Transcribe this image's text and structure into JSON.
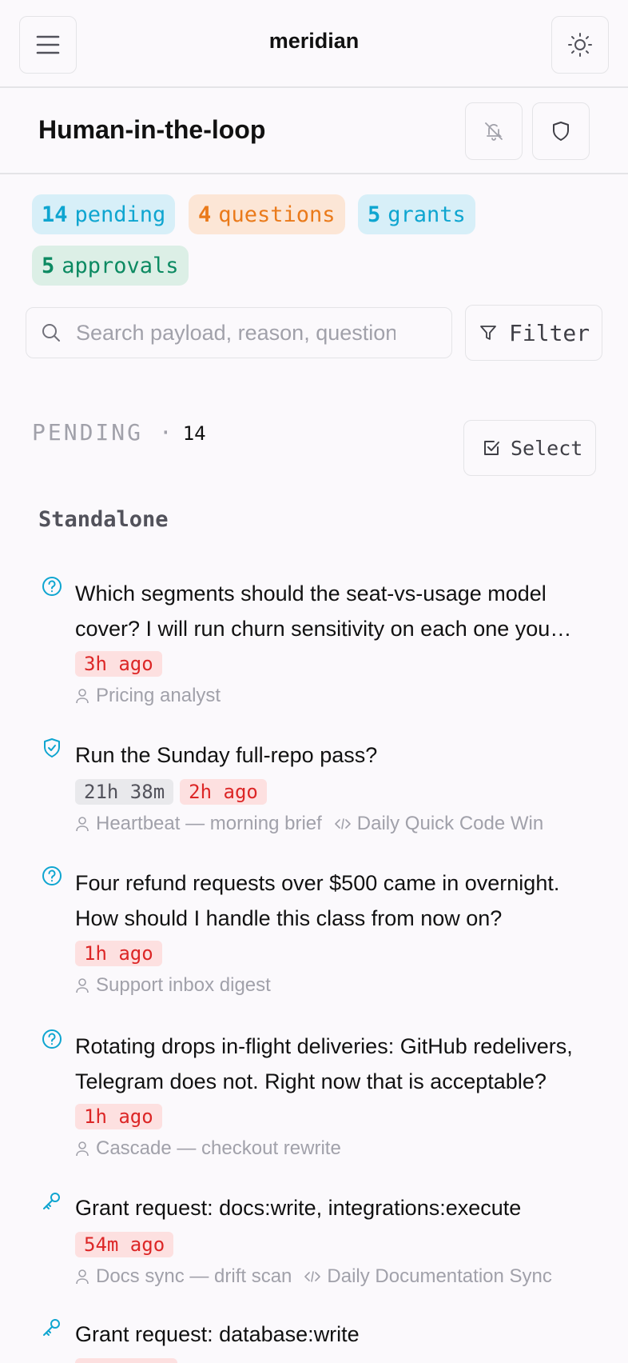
{
  "app": {
    "title": "meridian"
  },
  "page": {
    "title": "Human-in-the-loop"
  },
  "icons": {
    "menu": "menu-icon",
    "theme": "sun-icon",
    "mute": "bell-off-icon",
    "shield": "shield-icon",
    "search": "search-icon",
    "filter": "filter-icon",
    "select": "checkbox-icon",
    "question": "help-circle-icon",
    "approval": "shield-check-icon",
    "grant": "key-icon",
    "agent": "user-icon",
    "code": "code-icon"
  },
  "colors": {
    "accent": "#0ea5d0",
    "warning": "#ea7a1a",
    "success": "#0c8a62",
    "danger": "#dc2626"
  },
  "stats": [
    {
      "count": "14",
      "label": "pending"
    },
    {
      "count": "4",
      "label": "questions"
    },
    {
      "count": "5",
      "label": "grants"
    },
    {
      "count": "5",
      "label": "approvals"
    }
  ],
  "search": {
    "placeholder": "Search payload, reason, question"
  },
  "filter": {
    "label": "Filter"
  },
  "section": {
    "label": "PENDING ·",
    "count": "14",
    "select_label": "Select"
  },
  "group": {
    "label": "Standalone"
  },
  "items": [
    {
      "type": "question",
      "text": "Which segments should the seat-vs-usage model cover? I will run churn sensitivity on each one you pick.",
      "badges": [
        "3h ago"
      ],
      "agent": "Pricing analyst",
      "source": ""
    },
    {
      "type": "approval",
      "text": "Run the Sunday full-repo pass?",
      "badges": [
        "21h 38m",
        "2h ago"
      ],
      "agent": "Heartbeat — morning brief",
      "source": "Daily Quick Code Win"
    },
    {
      "type": "question",
      "text": "Four refund requests over $500 came in overnight. How should I handle this class from now on?",
      "badges": [
        "1h ago"
      ],
      "agent": "Support inbox digest",
      "source": ""
    },
    {
      "type": "question",
      "text": "Rotating drops in-flight deliveries: GitHub redelivers, Telegram does not. Right now that is acceptable?",
      "badges": [
        "1h ago"
      ],
      "agent": "Cascade — checkout rewrite",
      "source": ""
    },
    {
      "type": "grant",
      "text": "Grant request: docs:write, integrations:execute",
      "badges": [
        "54m ago"
      ],
      "agent": "Docs sync — drift scan",
      "source": "Daily Documentation Sync"
    },
    {
      "type": "grant",
      "text": "Grant request: database:write",
      "badges": [],
      "agent": "",
      "source": ""
    }
  ]
}
